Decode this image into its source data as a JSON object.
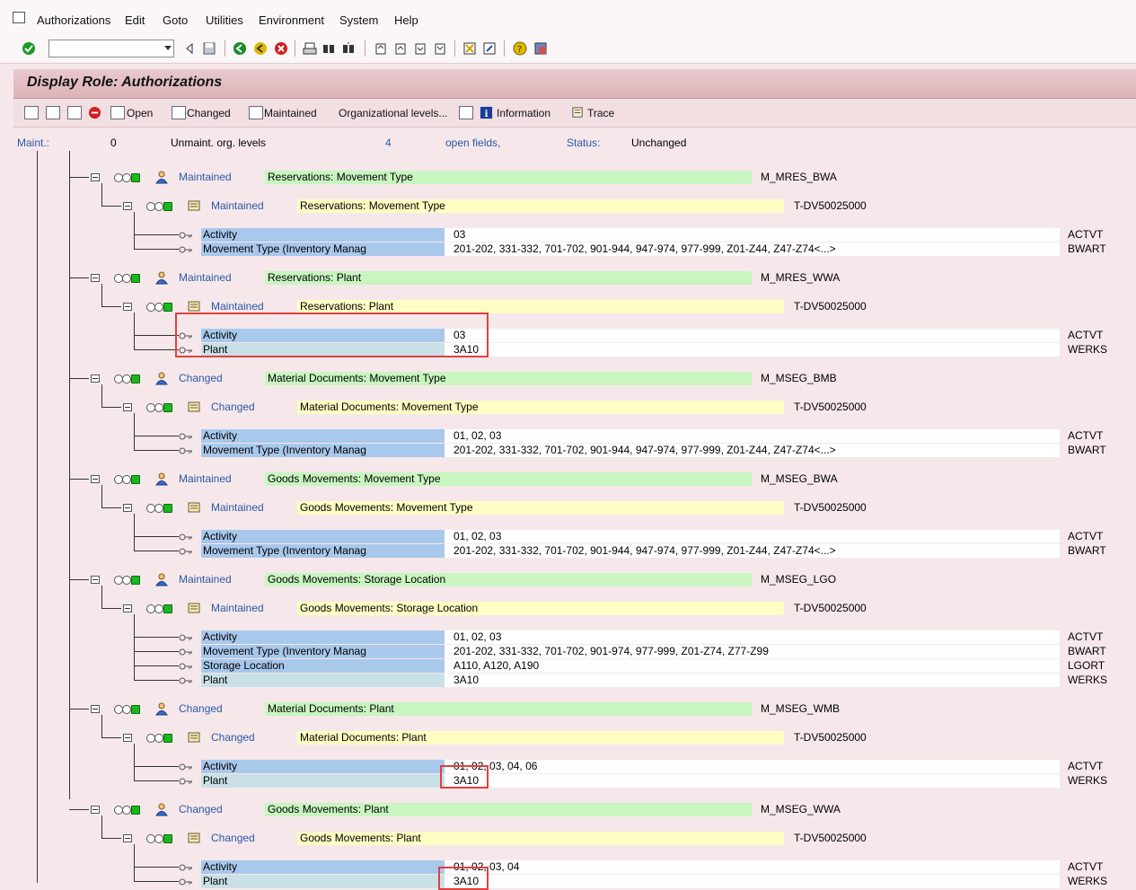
{
  "menu": {
    "items": [
      "Authorizations",
      "Edit",
      "Goto",
      "Utilities",
      "Environment",
      "System",
      "Help"
    ]
  },
  "toolbar": {
    "command_field_value": ""
  },
  "title": "Display Role: Authorizations",
  "app_toolbar": {
    "open": "Open",
    "changed": "Changed",
    "maintained": "Maintained",
    "org_levels": "Organizational levels...",
    "information": "Information",
    "trace": "Trace"
  },
  "status_line": {
    "maint_label": "Maint.:",
    "maint_count": "0",
    "unmaint_label": "Unmaint. org. levels",
    "open_count": "4",
    "open_label": "open fields,",
    "status_label": "Status:",
    "status_value": "Unchanged"
  },
  "colors": {
    "object_bar": "#c8f5c0",
    "auth_bar": "#fdfdc4",
    "field_blue": "#a8c8ec",
    "field_teal": "#c8e0e6",
    "highlight": "#e04040"
  },
  "groups": [
    {
      "status": "Maintained",
      "object_text": "Reservations: Movement Type",
      "object": "M_MRES_BWA",
      "auth_status": "Maintained",
      "auth_text": "Reservations: Movement Type",
      "auth": "T-DV50025000",
      "fields": [
        {
          "label": "Activity",
          "value": "03",
          "id": "ACTVT",
          "style": "b"
        },
        {
          "label": "Movement Type (Inventory Manag",
          "value": "201-202, 331-332, 701-702, 901-944, 947-974, 977-999, Z01-Z44, Z47-Z74<...>",
          "id": "BWART",
          "style": "b"
        }
      ]
    },
    {
      "status": "Maintained",
      "object_text": "Reservations: Plant",
      "object": "M_MRES_WWA",
      "auth_status": "Maintained",
      "auth_text": "Reservations: Plant",
      "auth": "T-DV50025000",
      "fields": [
        {
          "label": "Activity",
          "value": "03",
          "id": "ACTVT",
          "style": "b"
        },
        {
          "label": "Plant",
          "value": "3A10",
          "id": "WERKS",
          "style": "t"
        }
      ]
    },
    {
      "status": "Changed",
      "object_text": "Material Documents: Movement Type",
      "object": "M_MSEG_BMB",
      "auth_status": "Changed",
      "auth_text": "Material Documents: Movement Type",
      "auth": "T-DV50025000",
      "fields": [
        {
          "label": "Activity",
          "value": "01, 02, 03",
          "id": "ACTVT",
          "style": "b"
        },
        {
          "label": "Movement Type (Inventory Manag",
          "value": "201-202, 331-332, 701-702, 901-944, 947-974, 977-999, Z01-Z44, Z47-Z74<...>",
          "id": "BWART",
          "style": "b"
        }
      ]
    },
    {
      "status": "Maintained",
      "object_text": "Goods Movements: Movement Type",
      "object": "M_MSEG_BWA",
      "auth_status": "Maintained",
      "auth_text": "Goods Movements: Movement Type",
      "auth": "T-DV50025000",
      "fields": [
        {
          "label": "Activity",
          "value": "01, 02, 03",
          "id": "ACTVT",
          "style": "b"
        },
        {
          "label": "Movement Type (Inventory Manag",
          "value": "201-202, 331-332, 701-702, 901-944, 947-974, 977-999, Z01-Z44, Z47-Z74<...>",
          "id": "BWART",
          "style": "b"
        }
      ]
    },
    {
      "status": "Maintained",
      "object_text": "Goods Movements: Storage Location",
      "object": "M_MSEG_LGO",
      "auth_status": "Maintained",
      "auth_text": "Goods Movements: Storage Location",
      "auth": "T-DV50025000",
      "fields": [
        {
          "label": "Activity",
          "value": "01, 02, 03",
          "id": "ACTVT",
          "style": "b"
        },
        {
          "label": "Movement Type (Inventory Manag",
          "value": "201-202, 331-332, 701-702, 901-974, 977-999, Z01-Z74, Z77-Z99",
          "id": "BWART",
          "style": "b"
        },
        {
          "label": "Storage Location",
          "value": "A110, A120, A190",
          "id": "LGORT",
          "style": "b"
        },
        {
          "label": "Plant",
          "value": "3A10",
          "id": "WERKS",
          "style": "t"
        }
      ]
    },
    {
      "status": "Changed",
      "object_text": "Material Documents: Plant",
      "object": "M_MSEG_WMB",
      "auth_status": "Changed",
      "auth_text": "Material Documents: Plant",
      "auth": "T-DV50025000",
      "fields": [
        {
          "label": "Activity",
          "value": "01, 02, 03, 04, 06",
          "id": "ACTVT",
          "style": "b"
        },
        {
          "label": "Plant",
          "value": "3A10",
          "id": "WERKS",
          "style": "t"
        }
      ]
    },
    {
      "status": "Changed",
      "object_text": "Goods Movements: Plant",
      "object": "M_MSEG_WWA",
      "auth_status": "Changed",
      "auth_text": "Goods Movements: Plant",
      "auth": "T-DV50025000",
      "fields": [
        {
          "label": "Activity",
          "value": "01, 02, 03, 04",
          "id": "ACTVT",
          "style": "b"
        },
        {
          "label": "Plant",
          "value": "3A10",
          "id": "WERKS",
          "style": "t"
        }
      ]
    }
  ]
}
